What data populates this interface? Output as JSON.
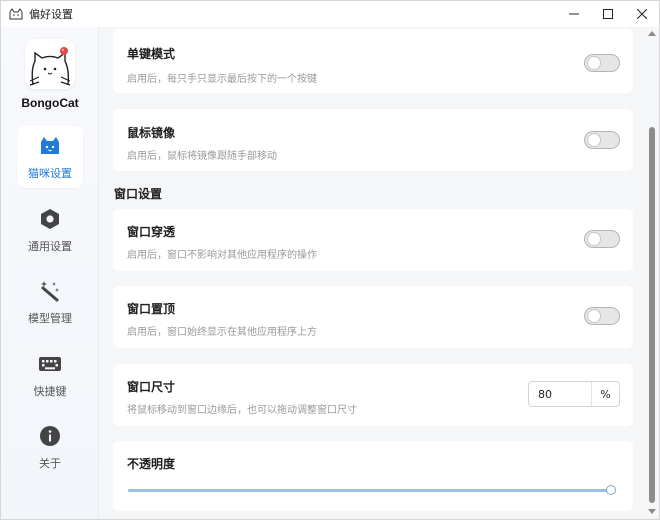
{
  "window": {
    "title": "偏好设置",
    "app_icon": "bongocat-app-icon",
    "controls": {
      "minimize": "minimize-icon",
      "maximize": "maximize-icon",
      "close": "close-icon"
    }
  },
  "sidebar": {
    "brand": "BongoCat",
    "items": [
      {
        "label": "猫咪设置",
        "icon": "cat-icon",
        "active": true
      },
      {
        "label": "通用设置",
        "icon": "settings-hexagon-icon",
        "active": false
      },
      {
        "label": "模型管理",
        "icon": "magic-wand-icon",
        "active": false
      },
      {
        "label": "快捷键",
        "icon": "keyboard-icon",
        "active": false
      },
      {
        "label": "关于",
        "icon": "info-icon",
        "active": false
      }
    ]
  },
  "main": {
    "cards": {
      "single_key": {
        "title": "单键模式",
        "desc": "启用后，每只手只显示最后按下的一个按键",
        "enabled": false
      },
      "mouse_mirror": {
        "title": "鼠标镜像",
        "desc": "启用后，鼠标将镜像跟随手部移动",
        "enabled": false
      },
      "window_passthrough": {
        "title": "窗口穿透",
        "desc": "启用后，窗口不影响对其他应用程序的操作",
        "enabled": false
      },
      "window_on_top": {
        "title": "窗口置顶",
        "desc": "启用后，窗口始终显示在其他应用程序上方",
        "enabled": false
      },
      "window_size": {
        "title": "窗口尺寸",
        "desc": "将鼠标移动到窗口边缘后，也可以拖动调整窗口尺寸",
        "value": "80",
        "unit": "%"
      },
      "opacity": {
        "title": "不透明度",
        "value_percent": 100
      }
    },
    "section_window": "窗口设置"
  },
  "colors": {
    "accent": "#1f7ad8",
    "toggle_off_track": "#e6e6e6",
    "card_bg": "#ffffff",
    "page_bg": "#f5f6f8"
  }
}
